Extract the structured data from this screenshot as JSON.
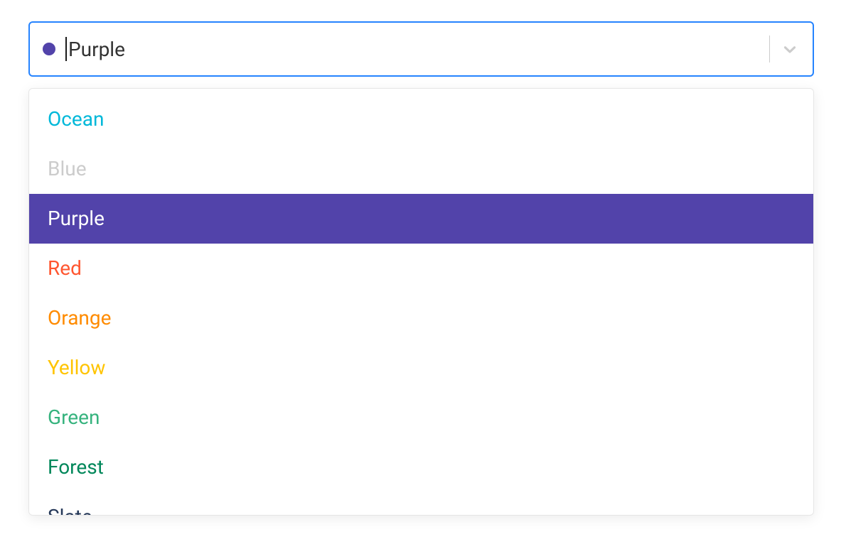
{
  "select": {
    "selected_label": "Purple",
    "selected_color": "#5243AA",
    "options": [
      {
        "label": "Ocean",
        "color": "#00B8D9",
        "selected": false,
        "disabled": false
      },
      {
        "label": "Blue",
        "color": "#0052CC",
        "selected": false,
        "disabled": true
      },
      {
        "label": "Purple",
        "color": "#5243AA",
        "selected": true,
        "disabled": false
      },
      {
        "label": "Red",
        "color": "#FF5630",
        "selected": false,
        "disabled": false
      },
      {
        "label": "Orange",
        "color": "#FF8B00",
        "selected": false,
        "disabled": false
      },
      {
        "label": "Yellow",
        "color": "#FFC400",
        "selected": false,
        "disabled": false
      },
      {
        "label": "Green",
        "color": "#36B37E",
        "selected": false,
        "disabled": false
      },
      {
        "label": "Forest",
        "color": "#00875A",
        "selected": false,
        "disabled": false
      },
      {
        "label": "Slate",
        "color": "#253858",
        "selected": false,
        "disabled": false
      }
    ]
  },
  "colors": {
    "focus_border": "#2684FF",
    "disabled_text": "#cccccc"
  }
}
